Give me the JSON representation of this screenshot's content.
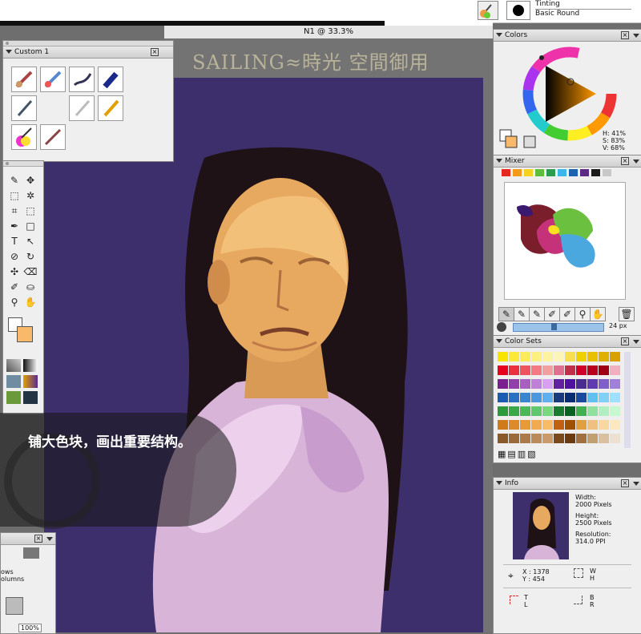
{
  "top": {
    "variant_line1": "Tinting",
    "variant_line2": "Basic Round"
  },
  "document": {
    "title": "N1 @ 33.3%",
    "watermark": "SAILING≈時光 空間御用"
  },
  "custom_palette": {
    "title": "Custom  1"
  },
  "colors_panel": {
    "title": "Colors",
    "h": "H: 41%",
    "s": "S: 83%",
    "v": "V: 68%"
  },
  "mixer_panel": {
    "title": "Mixer",
    "brush_size": "24 px",
    "swatches": [
      "#e52920",
      "#f39a1b",
      "#f5d21f",
      "#5cbf37",
      "#2e9b4e",
      "#3ab6e8",
      "#1c63b0",
      "#5b2a86",
      "#1b1b1b",
      "#c8c8c8"
    ]
  },
  "colorsets_panel": {
    "title": "Color Sets"
  },
  "info_panel": {
    "title": "Info",
    "width_label": "Width:",
    "width_value": "2000 Pixels",
    "height_label": "Height:",
    "height_value": "2500 Pixels",
    "resolution_label": "Resolution:",
    "resolution_value": "314.0 PPI",
    "x": "X : 1378",
    "y": "Y : 454",
    "w": "W",
    "h": "H",
    "t": "T",
    "l": "L",
    "b": "B",
    "r": "R"
  },
  "layers_panel": {
    "line1": "ows",
    "line2": "olumns",
    "zoom": "100%"
  },
  "overlay": {
    "caption": "铺大色块，画出重要结构。"
  },
  "colors": {
    "canvas_bg": "#3d2f6b",
    "accent": "#f9b96a"
  }
}
